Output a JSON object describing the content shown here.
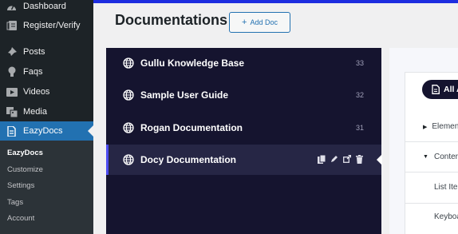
{
  "sidebar": {
    "items": [
      {
        "label": "Dashboard",
        "icon": "dashboard-icon"
      },
      {
        "label": "Register/Verify",
        "icon": "register-icon"
      },
      {
        "label": "Posts",
        "icon": "pin-icon"
      },
      {
        "label": "Faqs",
        "icon": "lightbulb-icon"
      },
      {
        "label": "Videos",
        "icon": "video-icon"
      },
      {
        "label": "Media",
        "icon": "media-icon"
      },
      {
        "label": "EazyDocs",
        "icon": "document-icon"
      }
    ],
    "submenu": [
      "EazyDocs",
      "Customize",
      "Settings",
      "Tags",
      "Account"
    ]
  },
  "header": {
    "title": "Documentations",
    "add_button_label": "Add Doc"
  },
  "docs": [
    {
      "name": "Gullu Knowledge Base",
      "count": "33"
    },
    {
      "name": "Sample User Guide",
      "count": "32"
    },
    {
      "name": "Rogan Documentation",
      "count": "31"
    },
    {
      "name": "Docy Documentation",
      "count": ""
    }
  ],
  "content": {
    "all_button_label": "All A",
    "sections": [
      "Elemen",
      "Conter"
    ],
    "items": [
      "List Ite",
      "Keyboa"
    ]
  },
  "colors": {
    "accent": "#2271b1",
    "panel": "#15142f",
    "active_border": "#4c4cf1",
    "sidebar": "#1d2327"
  }
}
